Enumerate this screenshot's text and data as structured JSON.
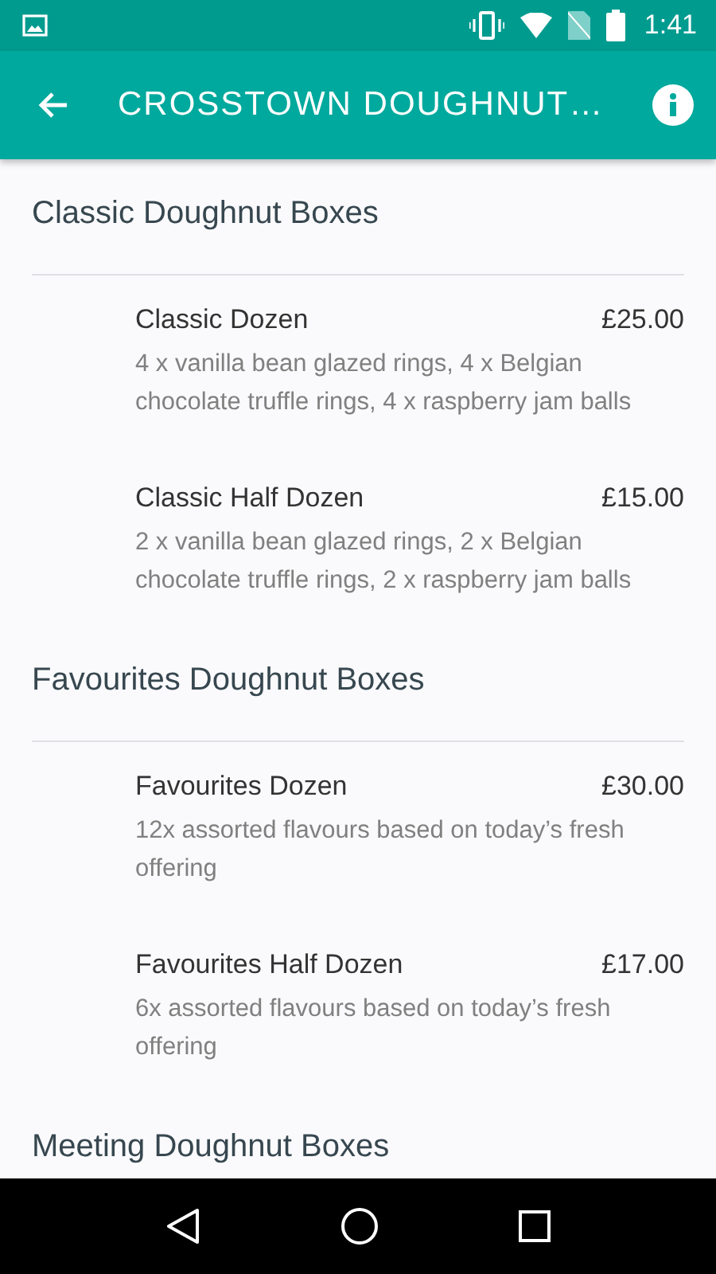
{
  "status_bar": {
    "time": "1:41"
  },
  "app_bar": {
    "title": "CROSSTOWN DOUGHNUT…"
  },
  "sections": [
    {
      "title": "Classic Doughnut Boxes",
      "items": [
        {
          "name": "Classic Dozen",
          "price": "£25.00",
          "description": "4 x vanilla bean glazed rings, 4 x Belgian chocolate truffle rings, 4 x raspberry jam balls"
        },
        {
          "name": "Classic Half Dozen",
          "price": "£15.00",
          "description": "2 x vanilla bean glazed rings, 2 x Belgian chocolate truffle rings, 2 x raspberry jam balls"
        }
      ]
    },
    {
      "title": "Favourites Doughnut Boxes",
      "items": [
        {
          "name": "Favourites Dozen",
          "price": "£30.00",
          "description": "12x assorted flavours based on today’s fresh offering"
        },
        {
          "name": "Favourites Half Dozen",
          "price": "£17.00",
          "description": "6x assorted flavours based on today’s fresh offering"
        }
      ]
    },
    {
      "title": "Meeting Doughnut Boxes"
    }
  ]
}
